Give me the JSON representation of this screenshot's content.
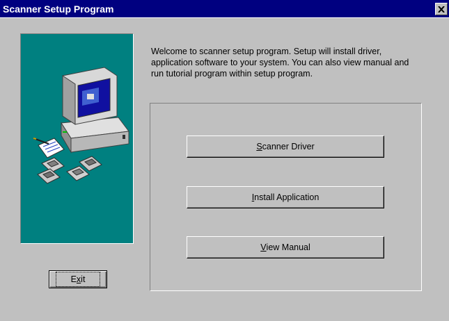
{
  "window": {
    "title": "Scanner Setup Program",
    "close_icon": "close-x-icon"
  },
  "welcome_text": "Welcome to scanner setup program. Setup will install driver,\napplication software to your system. You can also view manual and\nrun tutorial program within setup program.",
  "buttons": {
    "scanner_driver": {
      "first": "S",
      "rest": "canner Driver"
    },
    "install_application": {
      "first": "I",
      "rest": "nstall Application"
    },
    "view_manual": {
      "first": "V",
      "rest": "iew Manual"
    },
    "exit": {
      "before": "E",
      "underlined": "x",
      "after": "it"
    }
  },
  "illustration": {
    "icon": "computer-with-floppy-disks-illustration",
    "panel_color": "#008080"
  },
  "colors": {
    "titlebar": "#000080",
    "face": "#c0c0c0"
  }
}
